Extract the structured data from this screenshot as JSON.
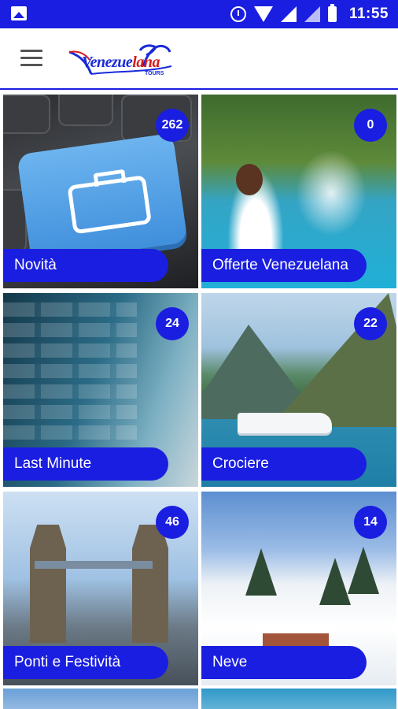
{
  "status_bar": {
    "time": "11:55",
    "icons": [
      "gallery-icon",
      "alarm-icon",
      "wifi-icon",
      "signal-icon",
      "battery-icon"
    ]
  },
  "app_bar": {
    "menu_icon": "hamburger-menu-icon",
    "logo_text_main": "Venezue",
    "logo_text_accent": "lana",
    "logo_sub": "TOURS"
  },
  "colors": {
    "primary": "#1a1ee0",
    "on_primary": "#ffffff"
  },
  "categories": [
    {
      "label": "Novità",
      "count": "262"
    },
    {
      "label": "Offerte Venezuelana",
      "count": "0"
    },
    {
      "label": "Last Minute",
      "count": "24"
    },
    {
      "label": "Crociere",
      "count": "22"
    },
    {
      "label": "Ponti e Festività",
      "count": "46"
    },
    {
      "label": "Neve",
      "count": "14"
    }
  ]
}
